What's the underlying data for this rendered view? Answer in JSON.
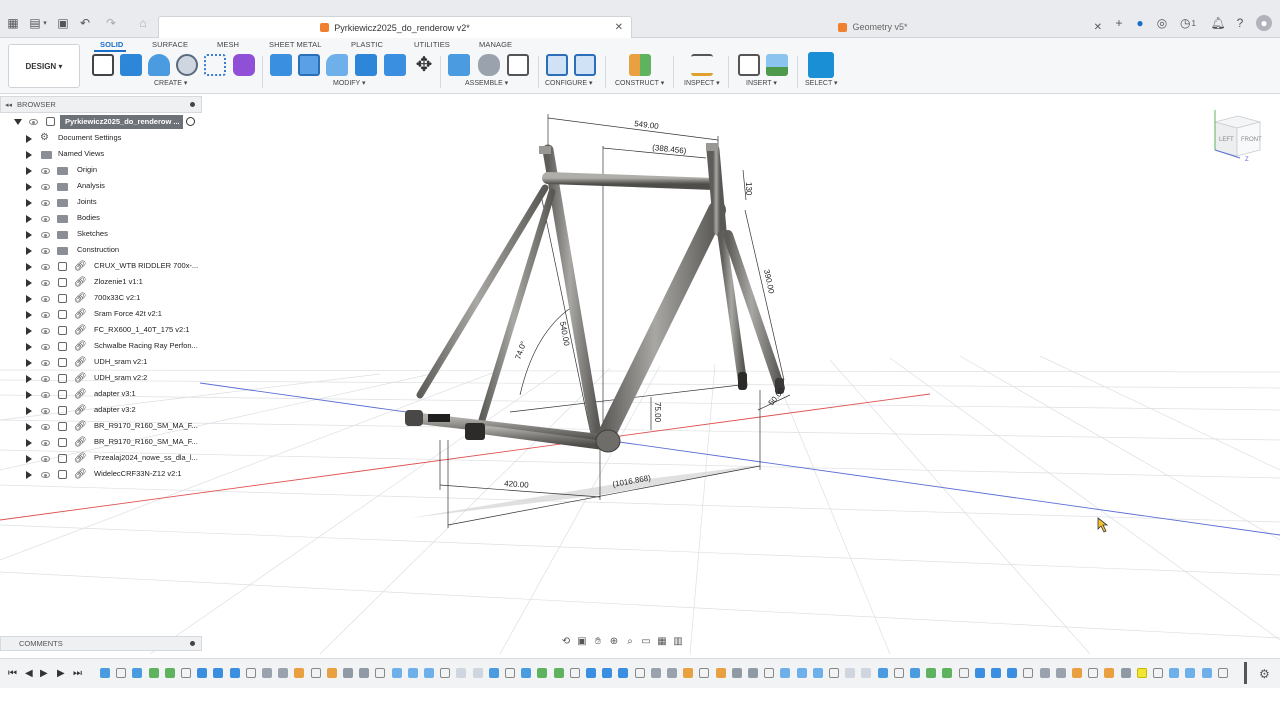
{
  "app": {
    "active_tab_title": "Pyrkiewicz2025_do_renderow v2*",
    "inactive_tab_title": "Geometry v5*",
    "notification_count": "1"
  },
  "ribbon": {
    "workspace": "DESIGN ▾",
    "tabs": [
      "SOLID",
      "SURFACE",
      "MESH",
      "SHEET METAL",
      "PLASTIC",
      "UTILITIES",
      "MANAGE"
    ],
    "groups": [
      "CREATE ▾",
      "MODIFY ▾",
      "ASSEMBLE ▾",
      "CONFIGURE ▾",
      "CONSTRUCT ▾",
      "INSPECT ▾",
      "INSERT ▾",
      "SELECT ▾"
    ]
  },
  "browser": {
    "title": "BROWSER",
    "root": "Pyrkiewicz2025_do_renderow ...",
    "items": [
      {
        "label": "Document Settings"
      },
      {
        "label": "Named Views"
      },
      {
        "label": "Origin"
      },
      {
        "label": "Analysis"
      },
      {
        "label": "Joints"
      },
      {
        "label": "Bodies"
      },
      {
        "label": "Sketches"
      },
      {
        "label": "Construction"
      },
      {
        "label": "CRUX_WTB RIDDLER 700x-..."
      },
      {
        "label": "Zlozenie1 v1:1"
      },
      {
        "label": "700x33C v2:1"
      },
      {
        "label": "Sram Force 42t v2:1"
      },
      {
        "label": "FC_RX600_1_40T_175 v2:1"
      },
      {
        "label": "Schwalbe Racing Ray Perfon..."
      },
      {
        "label": "UDH_sram v2:1"
      },
      {
        "label": "UDH_sram v2:2"
      },
      {
        "label": "adapter v3:1"
      },
      {
        "label": "adapter v3:2"
      },
      {
        "label": "BR_R9170_R160_SM_MA_F..."
      },
      {
        "label": "BR_R9170_R160_SM_MA_F..."
      },
      {
        "label": "Przealaj2024_nowe_ss_dla_l..."
      },
      {
        "label": "WidelecCRF33N-Z12 v2:1"
      }
    ]
  },
  "comments": {
    "title": "COMMENTS"
  },
  "viewcube": {
    "left": "LEFT",
    "front": "FRONT"
  },
  "dimensions": {
    "top_tube": "549.00",
    "reach_ref": "(388.456)",
    "head_tube": "130",
    "fork": "390.00",
    "seat_tube": "540.00",
    "seat_angle": "74.0°",
    "bb_drop": "75.00",
    "chainstay": "420.00",
    "wheelbase_ref": "(1016.868)",
    "fork_offset": "50.00"
  },
  "colors": {
    "accent": "#1a6fc9",
    "tab_icon": "#f08030",
    "axis_red": "#e05050",
    "axis_blue": "#5b6fd6",
    "frame": "#7d7b78"
  }
}
